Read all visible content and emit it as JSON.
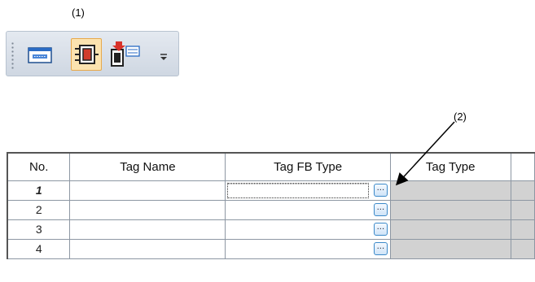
{
  "callouts": {
    "toolbar": "(1)",
    "button": "(2)"
  },
  "toolbar": {
    "buttons": [
      {
        "icon": "window-icon"
      },
      {
        "icon": "tag-fb-icon"
      },
      {
        "icon": "fb-property-icon"
      }
    ],
    "overflow_icon": "overflow-dropdown-icon"
  },
  "table": {
    "columns": [
      "No.",
      "Tag Name",
      "Tag FB Type",
      "Tag Type",
      ""
    ],
    "rows": [
      {
        "no": "1",
        "tag_name": "",
        "tag_fb_type": "",
        "tag_type": ""
      },
      {
        "no": "2",
        "tag_name": "",
        "tag_fb_type": "",
        "tag_type": ""
      },
      {
        "no": "3",
        "tag_name": "",
        "tag_fb_type": "",
        "tag_type": ""
      },
      {
        "no": "4",
        "tag_name": "",
        "tag_fb_type": "",
        "tag_type": ""
      }
    ],
    "browse_button_label": "..."
  },
  "colors": {
    "gray_cell": "#d2d2d2",
    "highlight": "#fbe3b0",
    "button_border": "#3b89c9"
  }
}
